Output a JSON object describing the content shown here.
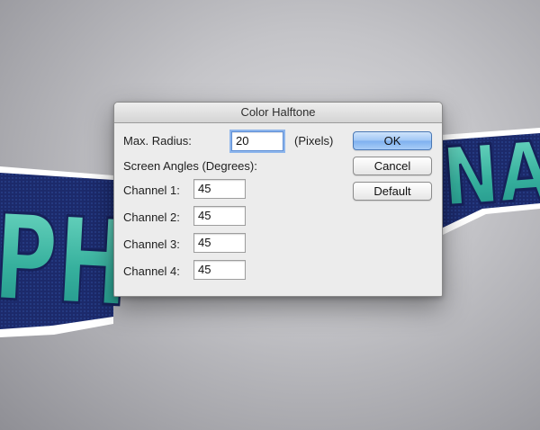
{
  "dialog": {
    "title": "Color Halftone",
    "max_radius_label": "Max. Radius:",
    "max_radius_value": "20",
    "max_radius_unit": "(Pixels)",
    "screen_angles_label": "Screen Angles (Degrees):",
    "channels": [
      {
        "label": "Channel 1:",
        "value": "45"
      },
      {
        "label": "Channel 2:",
        "value": "45"
      },
      {
        "label": "Channel 3:",
        "value": "45"
      },
      {
        "label": "Channel 4:",
        "value": "45"
      }
    ],
    "buttons": {
      "ok": "OK",
      "cancel": "Cancel",
      "default": "Default"
    }
  },
  "artwork": {
    "left_text": "PH",
    "right_text": "NA",
    "fill_color": "#3db3a0",
    "stroke_color": "#1c2a6b",
    "outline_color": "#ffffff"
  }
}
